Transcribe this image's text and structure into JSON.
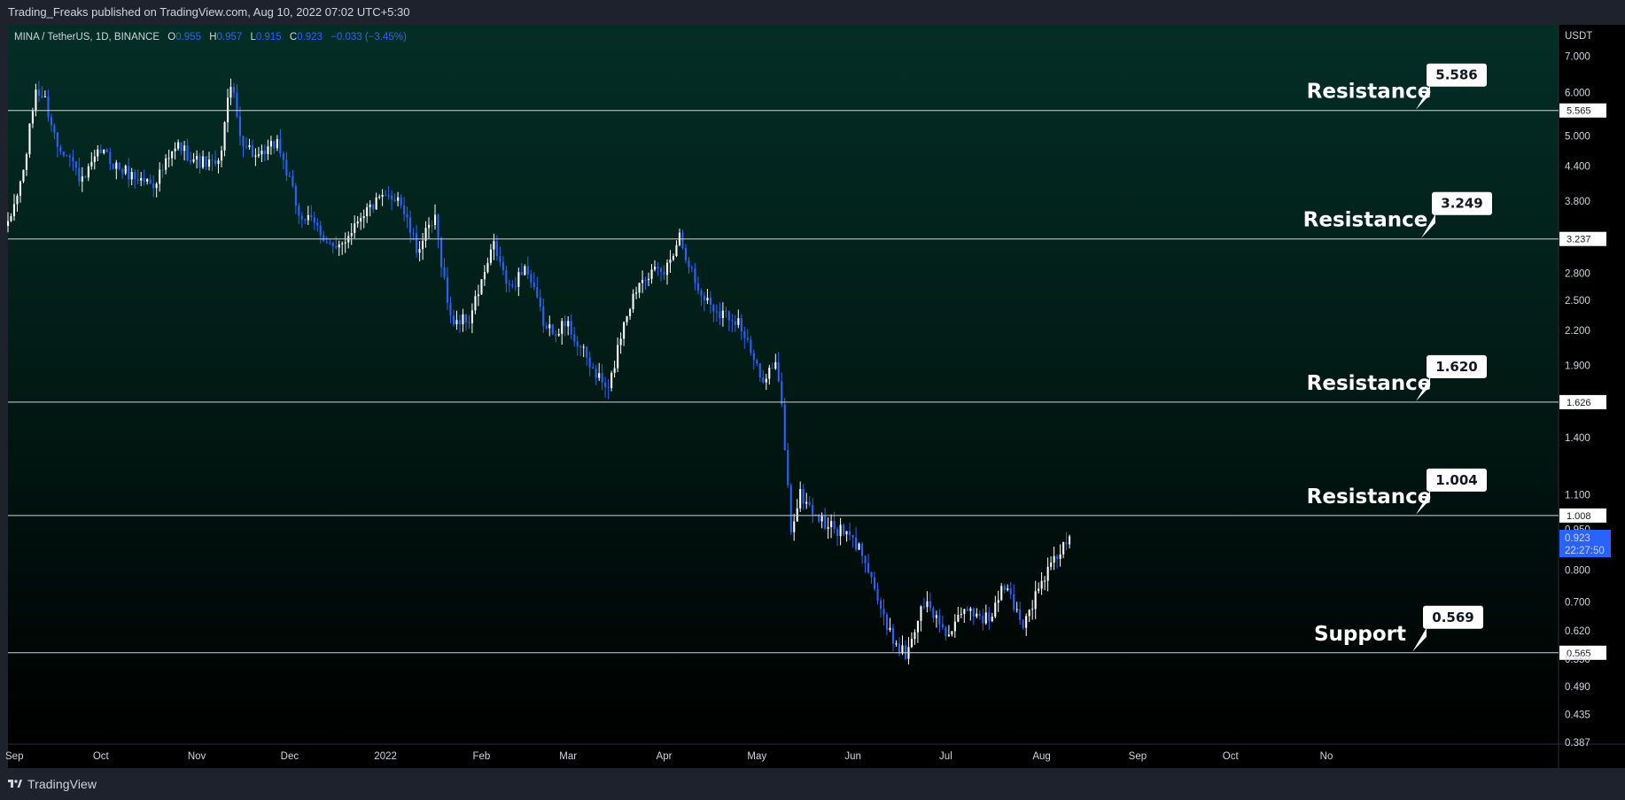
{
  "header": {
    "published": "Trading_Freaks published on TradingView.com, Aug 10, 2022 07:02 UTC+5:30"
  },
  "legend": {
    "symbol": "MINA / TetherUS, 1D, BINANCE",
    "o_label": "O",
    "o_value": "0.955",
    "h_label": "H",
    "h_value": "0.957",
    "l_label": "L",
    "l_value": "0.915",
    "c_label": "C",
    "c_value": "0.923",
    "change": "−0.033 (−3.45%)"
  },
  "footer": {
    "brand": "TradingView",
    "logo_icon": "tradingview-logo-icon"
  },
  "colors": {
    "up": "#ffffff",
    "down": "#2962ff",
    "background_top": "#032e26",
    "background_bottom": "#000000",
    "current_price_badge": "#2962ff"
  },
  "chart_data": {
    "type": "candlestick",
    "instrument": "MINA / TetherUS",
    "interval": "1D",
    "exchange": "BINANCE",
    "y_scale": "log",
    "ylim": [
      0.37,
      7.6
    ],
    "y_unit": "USDT",
    "y_ticks": [
      "7.000",
      "6.000",
      "5.000",
      "4.400",
      "3.800",
      "2.800",
      "2.500",
      "2.200",
      "1.900",
      "1.400",
      "1.100",
      "0.950",
      "0.800",
      "0.700",
      "0.620",
      "0.550",
      "0.490",
      "0.435",
      "0.387"
    ],
    "x_ticks": [
      "Sep",
      "Oct",
      "Nov",
      "Dec",
      "2022",
      "Feb",
      "Mar",
      "Apr",
      "May",
      "Jun",
      "Jul",
      "Aug",
      "Sep",
      "Oct",
      "No"
    ],
    "levels": [
      {
        "label": "Resistance",
        "callout": "5.586",
        "axis_label": "5.565",
        "value": 5.565
      },
      {
        "label": "Resistance",
        "callout": "3.249",
        "axis_label": "3.237",
        "value": 3.237
      },
      {
        "label": "Resistance",
        "callout": "1.620",
        "axis_label": "1.626",
        "value": 1.626
      },
      {
        "label": "Resistance",
        "callout": "1.004",
        "axis_label": "1.008",
        "value": 1.008
      },
      {
        "label": "Support",
        "callout": "0.569",
        "axis_label": "0.565",
        "value": 0.565
      }
    ],
    "current_price": {
      "value": "0.923",
      "countdown": "22:27:50"
    },
    "price_path": [
      {
        "date": "2021-09-01",
        "close": 3.4
      },
      {
        "date": "2021-09-06",
        "close": 4.3
      },
      {
        "date": "2021-09-10",
        "close": 6.1
      },
      {
        "date": "2021-09-13",
        "close": 5.8
      },
      {
        "date": "2021-09-17",
        "close": 4.8
      },
      {
        "date": "2021-09-20",
        "close": 4.7
      },
      {
        "date": "2021-09-25",
        "close": 4.1
      },
      {
        "date": "2021-10-01",
        "close": 4.7
      },
      {
        "date": "2021-10-06",
        "close": 4.4
      },
      {
        "date": "2021-10-12",
        "close": 4.2
      },
      {
        "date": "2021-10-18",
        "close": 4.1
      },
      {
        "date": "2021-10-26",
        "close": 4.8
      },
      {
        "date": "2021-11-01",
        "close": 4.5
      },
      {
        "date": "2021-11-08",
        "close": 4.4
      },
      {
        "date": "2021-11-12",
        "close": 6.3
      },
      {
        "date": "2021-11-15",
        "close": 5.0
      },
      {
        "date": "2021-11-21",
        "close": 4.5
      },
      {
        "date": "2021-11-27",
        "close": 4.9
      },
      {
        "date": "2021-12-04",
        "close": 3.6
      },
      {
        "date": "2021-12-10",
        "close": 3.4
      },
      {
        "date": "2021-12-16",
        "close": 3.05
      },
      {
        "date": "2021-12-24",
        "close": 3.6
      },
      {
        "date": "2021-12-30",
        "close": 3.8
      },
      {
        "date": "2022-01-05",
        "close": 3.9
      },
      {
        "date": "2022-01-11",
        "close": 3.1
      },
      {
        "date": "2022-01-17",
        "close": 3.5
      },
      {
        "date": "2022-01-22",
        "close": 2.3
      },
      {
        "date": "2022-01-28",
        "close": 2.3
      },
      {
        "date": "2022-02-05",
        "close": 3.15
      },
      {
        "date": "2022-02-10",
        "close": 2.6
      },
      {
        "date": "2022-02-15",
        "close": 2.9
      },
      {
        "date": "2022-02-22",
        "close": 2.2
      },
      {
        "date": "2022-03-01",
        "close": 2.25
      },
      {
        "date": "2022-03-08",
        "close": 1.9
      },
      {
        "date": "2022-03-14",
        "close": 1.7
      },
      {
        "date": "2022-03-19",
        "close": 2.3
      },
      {
        "date": "2022-03-25",
        "close": 2.8
      },
      {
        "date": "2022-04-01",
        "close": 2.8
      },
      {
        "date": "2022-04-06",
        "close": 3.3
      },
      {
        "date": "2022-04-12",
        "close": 2.6
      },
      {
        "date": "2022-04-18",
        "close": 2.4
      },
      {
        "date": "2022-04-25",
        "close": 2.3
      },
      {
        "date": "2022-05-02",
        "close": 1.8
      },
      {
        "date": "2022-05-07",
        "close": 1.9
      },
      {
        "date": "2022-05-09",
        "close": 1.6
      },
      {
        "date": "2022-05-12",
        "close": 0.95
      },
      {
        "date": "2022-05-15",
        "close": 1.1
      },
      {
        "date": "2022-05-22",
        "close": 0.98
      },
      {
        "date": "2022-05-30",
        "close": 0.93
      },
      {
        "date": "2022-06-05",
        "close": 0.85
      },
      {
        "date": "2022-06-12",
        "close": 0.62
      },
      {
        "date": "2022-06-18",
        "close": 0.56
      },
      {
        "date": "2022-06-24",
        "close": 0.7
      },
      {
        "date": "2022-07-02",
        "close": 0.61
      },
      {
        "date": "2022-07-08",
        "close": 0.68
      },
      {
        "date": "2022-07-15",
        "close": 0.65
      },
      {
        "date": "2022-07-20",
        "close": 0.75
      },
      {
        "date": "2022-07-26",
        "close": 0.64
      },
      {
        "date": "2022-08-02",
        "close": 0.78
      },
      {
        "date": "2022-08-10",
        "close": 0.923
      }
    ]
  }
}
